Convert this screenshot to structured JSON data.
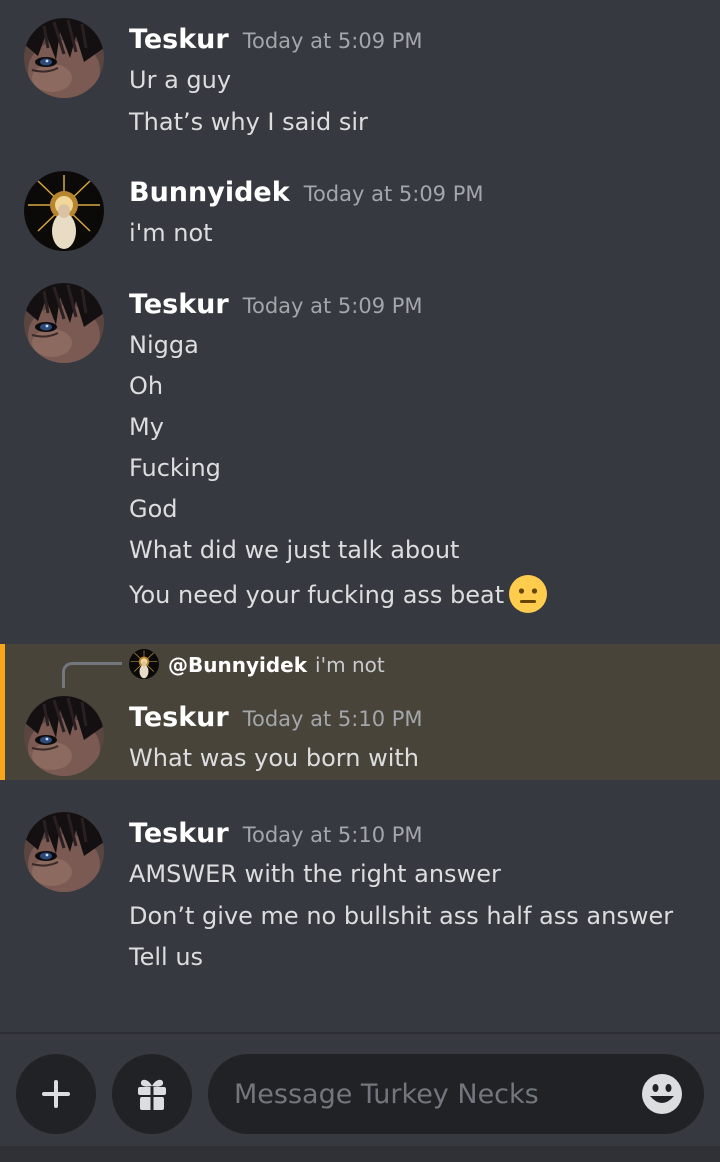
{
  "channel": {
    "name": "Turkey Necks"
  },
  "messages": [
    {
      "author": "Teskur",
      "timestamp": "Today at 5:09 PM",
      "lines": [
        "Ur a guy",
        "That’s why I said sir"
      ]
    },
    {
      "author": "Bunnyidek",
      "timestamp": "Today at 5:09 PM",
      "lines": [
        "i'm not"
      ]
    },
    {
      "author": "Teskur",
      "timestamp": "Today at 5:09 PM",
      "lines": [
        "Nigga",
        "Oh",
        "My",
        "Fucking",
        "God",
        "What did we just talk about",
        "You need your fucking ass beat"
      ],
      "trailing_emoji": "neutral-face-emoji"
    },
    {
      "author": "Teskur",
      "timestamp": "Today at 5:10 PM",
      "reply_to": {
        "author": "@Bunnyidek",
        "text": "i'm not"
      },
      "highlighted": true,
      "lines": [
        "What was you born with"
      ]
    },
    {
      "author": "Teskur",
      "timestamp": "Today at 5:10 PM",
      "lines": [
        "AMSWER with the right answer",
        "Don’t give me no bullshit ass half ass answer",
        "Tell us"
      ]
    }
  ],
  "composer": {
    "placeholder": "Message Turkey Necks",
    "add_icon": "plus-icon",
    "gift_icon": "gift-icon",
    "emoji_icon": "emoji-smile-icon"
  },
  "colors": {
    "background": "#36393f",
    "highlight_background": "#49443a",
    "highlight_bar": "#faa61a",
    "input_background": "#202225",
    "username": "#ffffff",
    "timestamp": "#a3a6aa",
    "message_text": "#dcddde"
  }
}
